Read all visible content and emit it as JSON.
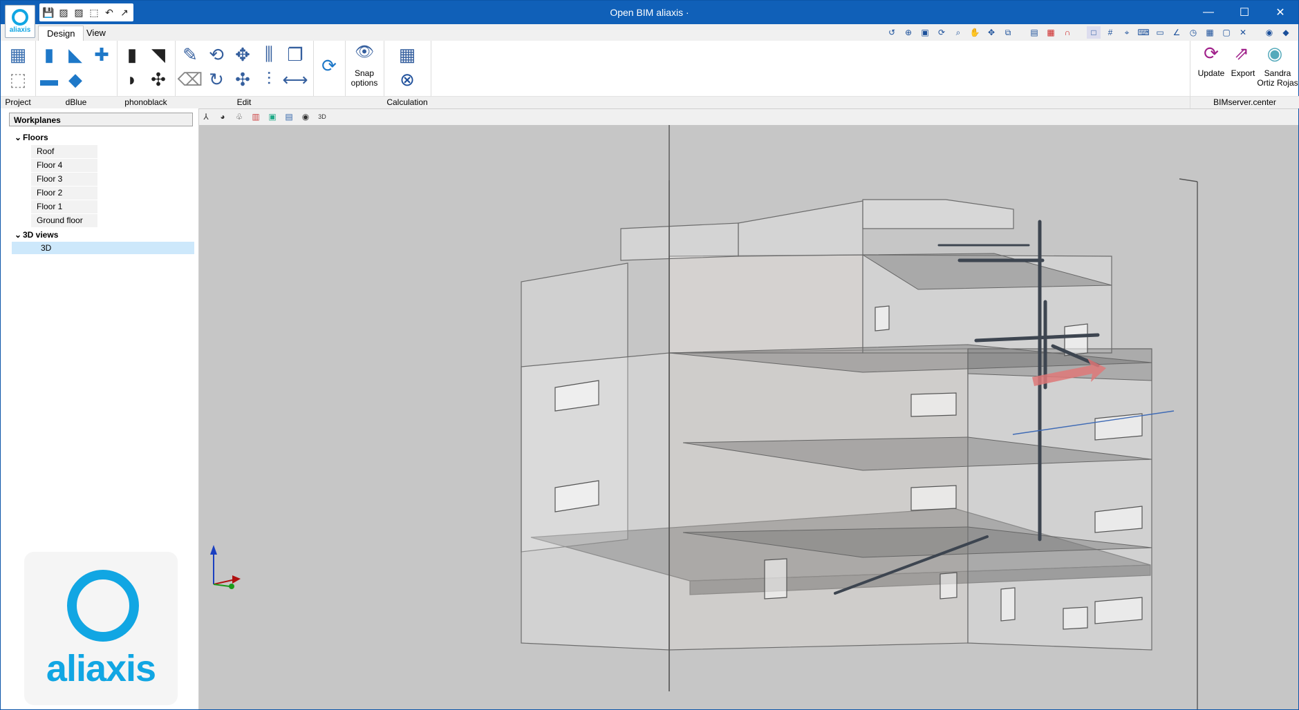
{
  "window": {
    "title": "Open BIM aliaxis ·"
  },
  "app_icon": {
    "name": "aliaxis"
  },
  "quick_access": [
    "save-icon",
    "image-icon",
    "image-icon",
    "cube-icon",
    "undo-icon",
    "export-icon"
  ],
  "tabs": [
    {
      "label": "Design",
      "active": true
    },
    {
      "label": "View",
      "active": false
    }
  ],
  "ribbon": {
    "groups": {
      "project": "Project",
      "dblue": "dBlue",
      "phonoblack": "phonoblack",
      "edit": "Edit",
      "snap": "Snap options",
      "calculation": "Calculation",
      "bimserver": "BIMserver.center"
    },
    "snap_label_line1": "Snap",
    "snap_label_line2": "options",
    "update_label": "Update",
    "export_label": "Export",
    "user_line1": "Sandra",
    "user_line2": "Ortiz Rojas"
  },
  "left_panel": {
    "header": "Workplanes",
    "floors_label": "Floors",
    "floors": [
      "Roof",
      "Floor 4",
      "Floor 3",
      "Floor 2",
      "Floor 1",
      "Ground floor"
    ],
    "views_label": "3D views",
    "views": [
      "3D"
    ]
  },
  "logo": {
    "word": "aliaxis",
    "color": "#11a6e3"
  },
  "colors": {
    "titlebar": "#1060b8",
    "viewport_bg": "#c6c6c6",
    "selection": "#cde8fb"
  }
}
